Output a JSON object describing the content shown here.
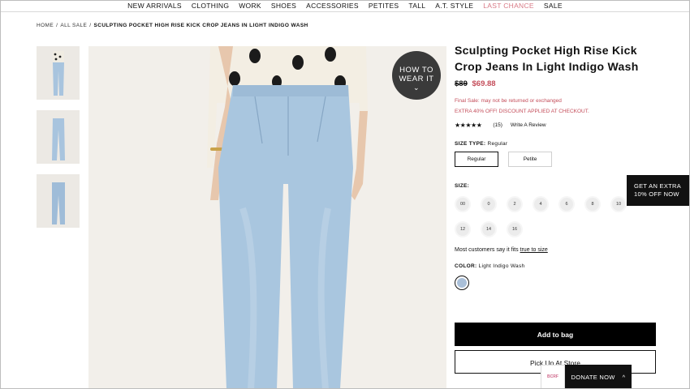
{
  "nav": {
    "items": [
      "NEW ARRIVALS",
      "CLOTHING",
      "WORK",
      "SHOES",
      "ACCESSORIES",
      "PETITES",
      "TALL",
      "A.T. STYLE",
      "LAST CHANCE",
      "SALE"
    ],
    "accent_item": "LAST CHANCE",
    "accent_color": "#d87a86"
  },
  "breadcrumb": {
    "home": "HOME",
    "all_sale": "ALL SALE",
    "current": "SCULPTING POCKET HIGH RISE KICK CROP JEANS IN LIGHT INDIGO WASH"
  },
  "hero": {
    "how_to_line1": "HOW TO",
    "how_to_line2": "WEAR IT",
    "chevron": "⌄"
  },
  "product": {
    "title": "Sculpting Pocket High Rise Kick Crop Jeans In Light Indigo Wash",
    "old_price": "$89",
    "new_price": "$69.88",
    "sale_color": "#c44d5a",
    "final_sale": "Final Sale: may not be returned or exchanged",
    "discount": "EXTRA 40% OFF! DISCOUNT APPLIED AT CHECKOUT.",
    "stars": "★★★★★",
    "rating": 4.5,
    "review_count": "(15)",
    "write_review": "Write A Review",
    "size_type_label": "SIZE TYPE:",
    "size_type_value": "Regular",
    "size_types": [
      "Regular",
      "Petite"
    ],
    "size_label": "SIZE:",
    "sizes": [
      "00",
      "0",
      "2",
      "4",
      "6",
      "8",
      "10",
      "12",
      "14",
      "16"
    ],
    "fit_text": "Most customers say it fits",
    "fit_link": "true to size",
    "color_label": "COLOR:",
    "color_value": "Light Indigo Wash",
    "swatch_color": "#a9bfd8"
  },
  "actions": {
    "add_to_bag": "Add to bag",
    "pickup": "Pick Up At Store"
  },
  "promo_tab": {
    "line1": "GET AN EXTRA",
    "line2": "10% OFF NOW"
  },
  "donate": {
    "logo": "BCRF",
    "label": "DONATE NOW",
    "chevron": "^"
  }
}
